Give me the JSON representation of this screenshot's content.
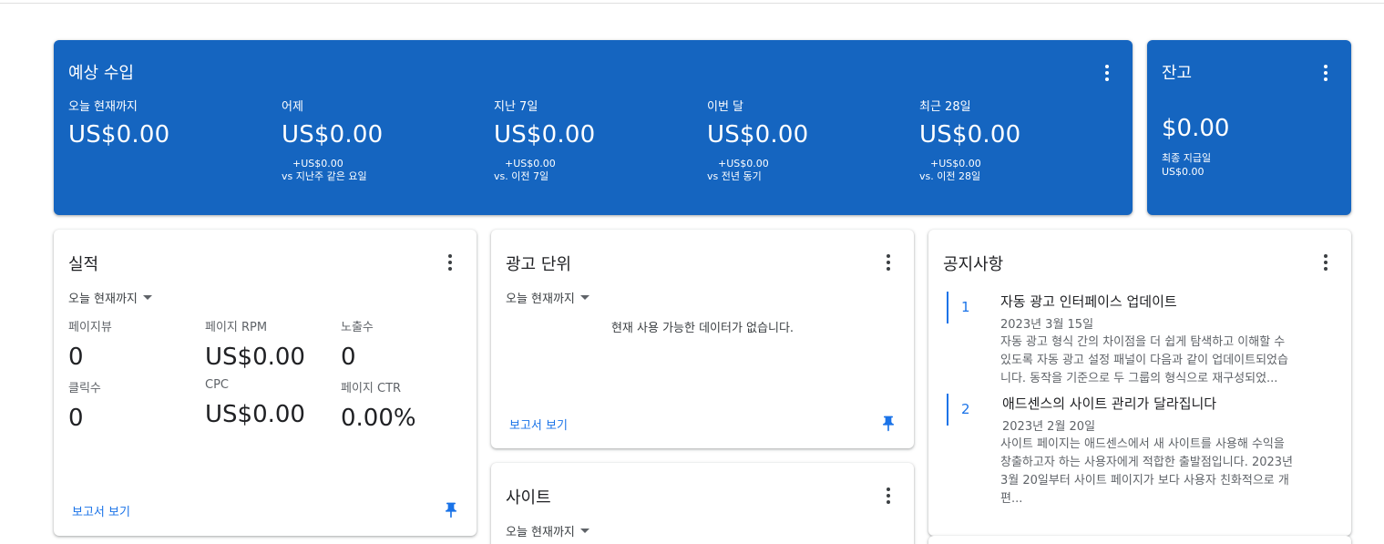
{
  "earnings": {
    "title": "예상 수입",
    "metrics": [
      {
        "label": "오늘 현재까지",
        "value": "US$0.00",
        "delta": "",
        "compare": ""
      },
      {
        "label": "어제",
        "value": "US$0.00",
        "delta": "+US$0.00",
        "compare": "vs 지난주 같은 요일"
      },
      {
        "label": "지난 7일",
        "value": "US$0.00",
        "delta": "+US$0.00",
        "compare": "vs. 이전 7일"
      },
      {
        "label": "이번 달",
        "value": "US$0.00",
        "delta": "+US$0.00",
        "compare": "vs 전년 동기"
      },
      {
        "label": "최근 28일",
        "value": "US$0.00",
        "delta": "+US$0.00",
        "compare": "vs. 이전 28일"
      }
    ]
  },
  "balance": {
    "title": "잔고",
    "value": "$0.00",
    "last_payment_label": "최종 지급일",
    "last_payment_value": "US$0.00"
  },
  "performance": {
    "title": "실적",
    "range": "오늘 현재까지",
    "metrics": [
      {
        "label": "페이지뷰",
        "value": "0"
      },
      {
        "label": "페이지 RPM",
        "value": "US$0.00"
      },
      {
        "label": "노출수",
        "value": "0"
      },
      {
        "label": "클릭수",
        "value": "0"
      },
      {
        "label": "CPC",
        "value": "US$0.00"
      },
      {
        "label": "페이지 CTR",
        "value": "0.00%"
      }
    ],
    "report_link": "보고서 보기"
  },
  "ad_units": {
    "title": "광고 단위",
    "range": "오늘 현재까지",
    "empty": "현재 사용 가능한 데이터가 없습니다.",
    "report_link": "보고서 보기"
  },
  "sites": {
    "title": "사이트",
    "range": "오늘 현재까지"
  },
  "notices": {
    "title": "공지사항",
    "items": [
      {
        "num": "1",
        "title": "자동 광고 인터페이스 업데이트",
        "date": "2023년 3월 15일",
        "lines": [
          "자동 광고 형식 간의 차이점을 더 쉽게 탐색하고 이해할 수",
          "있도록 자동 광고 설정 패널이 다음과 같이 업데이트되었습",
          "니다. 동작을 기준으로 두 그룹의 형식으로 재구성되었..."
        ]
      },
      {
        "num": "2",
        "title": "애드센스의 사이트 관리가 달라집니다",
        "date": "2023년 2월 20일",
        "lines": [
          "사이트 페이지는 애드센스에서 새 사이트를 사용해 수익을",
          "창출하고자 하는 사용자에게 적합한 출발점입니다. 2023년",
          "3월 20일부터 사이트 페이지가 보다 사용자 친화적으로 개",
          "편..."
        ]
      }
    ]
  },
  "colors": {
    "brand_blue": "#1565c0",
    "link_blue": "#1a73e8"
  }
}
